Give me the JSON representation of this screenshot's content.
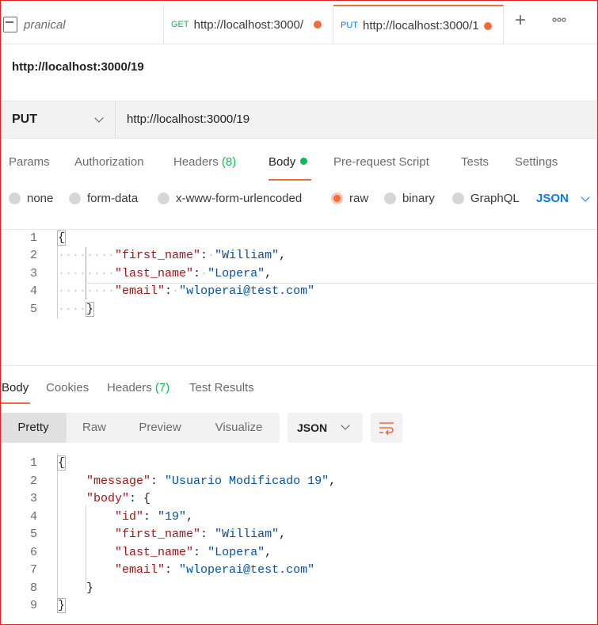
{
  "tabs": [
    {
      "name": "pranical"
    },
    {
      "method": "GET",
      "url": "http://localhost:3000/"
    },
    {
      "method": "PUT",
      "url": "http://localhost:3000/1"
    }
  ],
  "tabbar": {
    "new_tab": "+",
    "more": "ooo"
  },
  "request": {
    "title": "http://localhost:3000/19",
    "method": "PUT",
    "url": "http://localhost:3000/19"
  },
  "request_tabs": {
    "params": "Params",
    "authorization": "Authorization",
    "headers": "Headers",
    "headers_count": "(8)",
    "body": "Body",
    "prerequest": "Pre-request Script",
    "tests": "Tests",
    "settings": "Settings"
  },
  "body_options": {
    "none": "none",
    "form_data": "form-data",
    "urlencoded": "x-www-form-urlencoded",
    "raw": "raw",
    "binary": "binary",
    "graphql": "GraphQL",
    "language": "JSON",
    "selected": "raw"
  },
  "request_body": {
    "line_numbers": [
      "1",
      "2",
      "3",
      "4",
      "5"
    ],
    "open": "{",
    "k1": "\"first_name\"",
    "v1": "\"William\"",
    "k2": "\"last_name\"",
    "v2": "\"Lopera\"",
    "k3": "\"email\"",
    "v3": "\"wloperai@test.com\"",
    "close": "}"
  },
  "response_tabs": {
    "body": "Body",
    "cookies": "Cookies",
    "headers": "Headers",
    "headers_count": "(7)",
    "test_results": "Test Results"
  },
  "response_view": {
    "pretty": "Pretty",
    "raw": "Raw",
    "preview": "Preview",
    "visualize": "Visualize",
    "format": "JSON"
  },
  "response_body": {
    "line_numbers": [
      "1",
      "2",
      "3",
      "4",
      "5",
      "6",
      "7",
      "8",
      "9"
    ],
    "open": "{",
    "k_message": "\"message\"",
    "v_message": "\"Usuario Modificado 19\"",
    "k_body": "\"body\"",
    "k_id": "\"id\"",
    "v_id": "\"19\"",
    "k_first": "\"first_name\"",
    "v_first": "\"William\"",
    "k_last": "\"last_name\"",
    "v_last": "\"Lopera\"",
    "k_email": "\"email\"",
    "v_email": "\"wloperai@test.com\"",
    "close_inner": "}",
    "close": "}"
  },
  "colors": {
    "accent": "#f26b3a",
    "green": "#0cbb52",
    "blue": "#097bed",
    "key": "#a31515",
    "string": "#0451a5"
  }
}
